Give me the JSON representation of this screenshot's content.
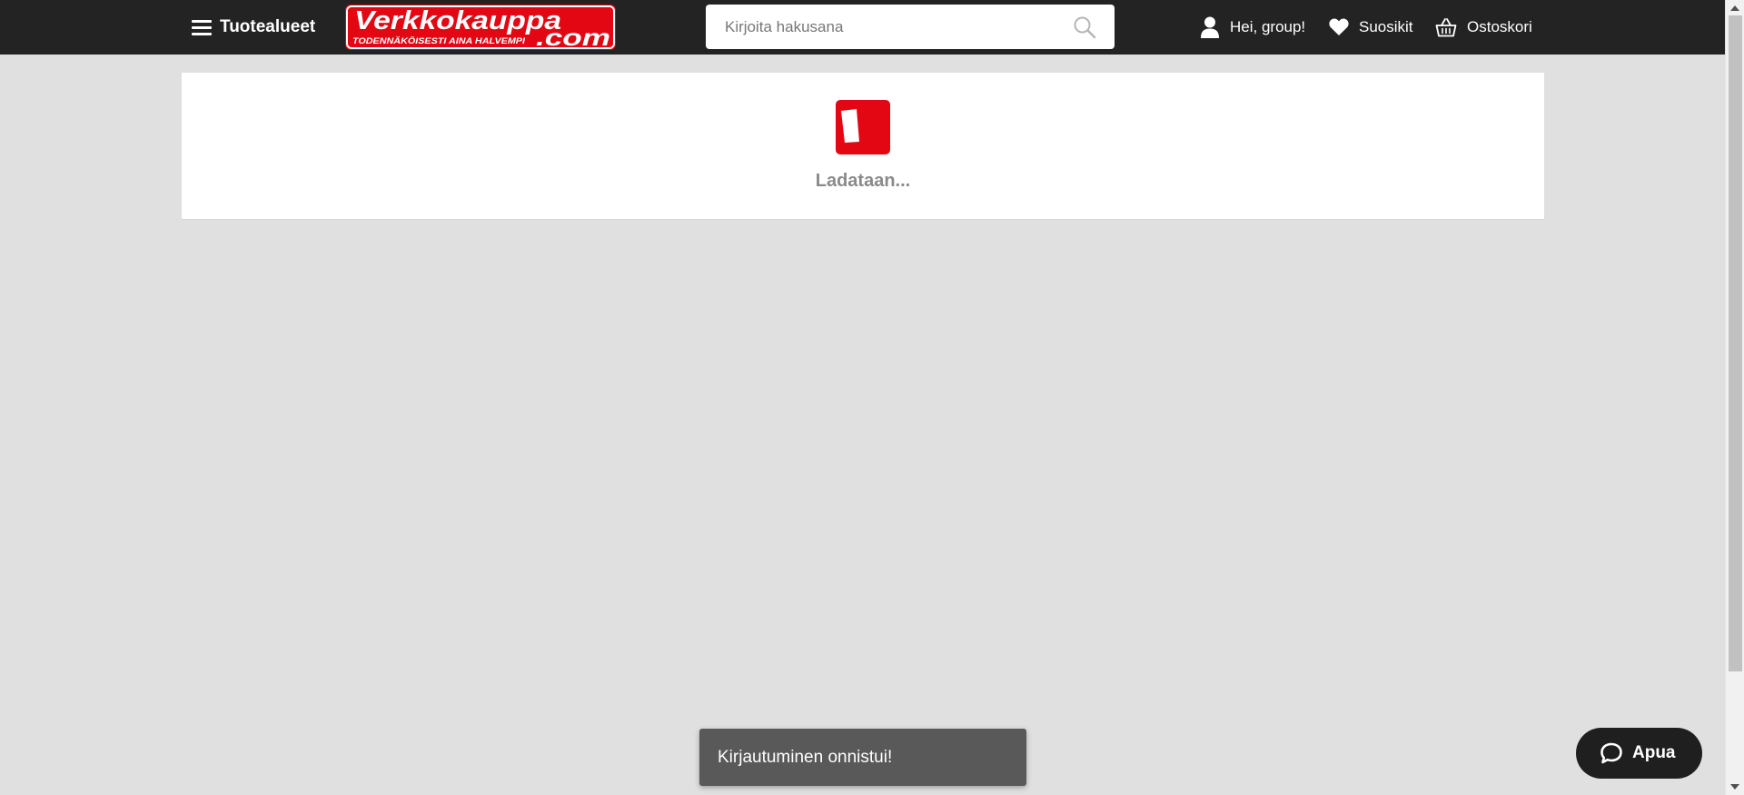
{
  "header": {
    "menu_label": "Tuotealueet",
    "logo": {
      "brand_text": "Verkkokauppa",
      "domain_text": ".com",
      "tagline": "TODENNÄKÖISESTI AINA HALVEMPI"
    },
    "search": {
      "placeholder": "Kirjoita hakusana",
      "value": ""
    },
    "account_label": "Hei, group!",
    "favorites_label": "Suosikit",
    "cart_label": "Ostoskori"
  },
  "main": {
    "loading_text": "Ladataan..."
  },
  "toast": {
    "message": "Kirjautuminen onnistui!"
  },
  "help": {
    "label": "Apua"
  },
  "colors": {
    "brand_red": "#e30613",
    "header_bg": "#232323",
    "page_bg": "#e0e0e0"
  }
}
